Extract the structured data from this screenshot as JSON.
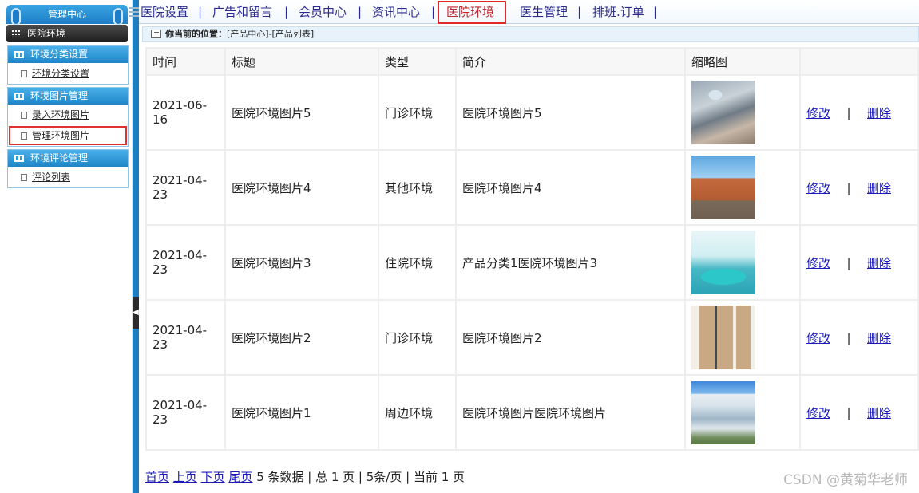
{
  "sidebar": {
    "title": "管理中心",
    "current": "医院环境",
    "groups": [
      {
        "header": "环境分类设置",
        "items": [
          "环境分类设置"
        ]
      },
      {
        "header": "环境图片管理",
        "items": [
          "录入环境图片",
          "管理环境图片"
        ]
      },
      {
        "header": "环境评论管理",
        "items": [
          "评论列表"
        ]
      }
    ],
    "highlighted_item": "管理环境图片"
  },
  "topnav": {
    "items": [
      "医院设置",
      "广告和留言",
      "会员中心",
      "资讯中心",
      "医院环境",
      "医生管理",
      "排班.订单"
    ],
    "separator": "|",
    "active": "医院环境"
  },
  "breadcrumb": {
    "label": "你当前的位置：",
    "path": "[产品中心]-[产品列表]"
  },
  "table": {
    "headers": [
      "时间",
      "标题",
      "类型",
      "简介",
      "缩略图",
      ""
    ],
    "edit_label": "修改",
    "delete_label": "删除",
    "pipe": "|",
    "rows": [
      {
        "date": "2021-06-16",
        "title": "医院环境图片5",
        "type": "门诊环境",
        "brief": "医院环境图片5"
      },
      {
        "date": "2021-04-23",
        "title": "医院环境图片4",
        "type": "其他环境",
        "brief": "医院环境图片4"
      },
      {
        "date": "2021-04-23",
        "title": "医院环境图片3",
        "type": "住院环境",
        "brief": "产品分类1医院环境图片3"
      },
      {
        "date": "2021-04-23",
        "title": "医院环境图片2",
        "type": "门诊环境",
        "brief": "医院环境图片2"
      },
      {
        "date": "2021-04-23",
        "title": "医院环境图片1",
        "type": "周边环境",
        "brief": "医院环境图片医院环境图片"
      }
    ]
  },
  "pager": {
    "first": "首页",
    "prev": "上页",
    "next": "下页",
    "last": "尾页",
    "summary": "5 条数据 | 总 1 页 | 5条/页 | 当前 1 页"
  },
  "watermark": "CSDN @黄菊华老师",
  "colors": {
    "accent_blue": "#1e7dc6",
    "highlight_red": "#e02a2a",
    "link_blue": "#1a1ab8",
    "nav_text": "#2b2b8f"
  }
}
